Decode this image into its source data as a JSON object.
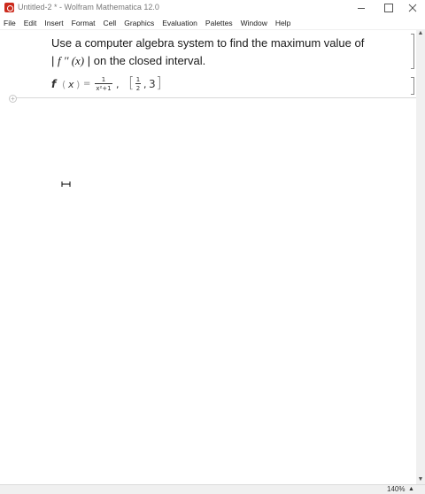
{
  "window": {
    "title": "Untitled-2 * - Wolfram Mathematica 12.0",
    "icon": "mathematica-icon"
  },
  "menu": [
    "File",
    "Edit",
    "Insert",
    "Format",
    "Cell",
    "Graphics",
    "Evaluation",
    "Palettes",
    "Window",
    "Help"
  ],
  "notebook": {
    "text_cell": {
      "line1": "Use a computer algebra system to find the maximum value of",
      "line2_bar_left": "|",
      "line2_fprime": "f '' (x)",
      "line2_bar_right": "|",
      "line2_rest": "on the closed interval."
    },
    "input_cell": {
      "function_name": "f",
      "open_paren": "(",
      "variable": "x",
      "close_paren": ")",
      "equals": "=",
      "frac_numerator": "1",
      "frac_denominator": "x²+1",
      "comma": ",",
      "interval_open": "[",
      "interval_frac_num": "1",
      "interval_frac_den": "2",
      "interval_sep": ",",
      "interval_end": "3",
      "interval_close": "]"
    }
  },
  "status": {
    "zoom": "140%"
  }
}
